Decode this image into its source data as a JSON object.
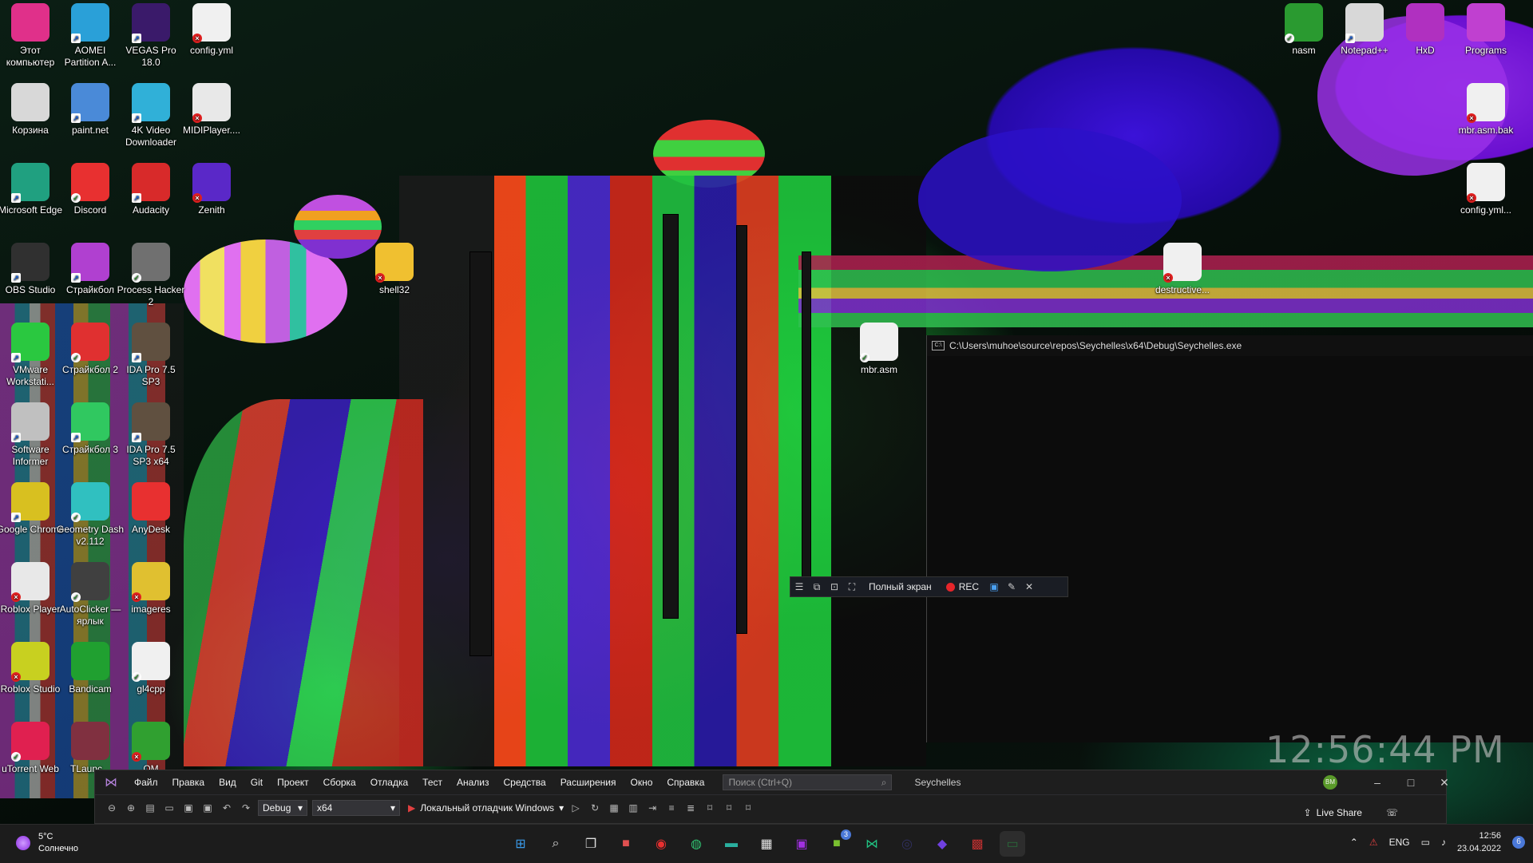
{
  "desktop": {
    "left_icons": [
      {
        "label": "Этот компьютер",
        "icon": "monitor-icon",
        "color": "#e0308a",
        "overlay": ""
      },
      {
        "label": "AOMEI Partition A...",
        "icon": "aomei-icon",
        "color": "#2aa0d8",
        "overlay": "sc"
      },
      {
        "label": "VEGAS Pro 18.0",
        "icon": "vegas-icon",
        "color": "#3a1a6a",
        "overlay": "sc"
      },
      {
        "label": "config.yml",
        "icon": "file-icon",
        "color": "#f0f0f0",
        "overlay": "x"
      },
      {
        "label": "Корзина",
        "icon": "recycle-bin-icon",
        "color": "#d8d8d8",
        "overlay": ""
      },
      {
        "label": "paint.net",
        "icon": "paintnet-icon",
        "color": "#4a8ad8",
        "overlay": "sc"
      },
      {
        "label": "4K Video Downloader",
        "icon": "4k-downloader-icon",
        "color": "#30b0d8",
        "overlay": "sc"
      },
      {
        "label": "MIDIPlayer....",
        "icon": "java-icon",
        "color": "#e8e8e8",
        "overlay": "x"
      },
      {
        "label": "Microsoft Edge",
        "icon": "edge-icon",
        "color": "#20a080",
        "overlay": "sc"
      },
      {
        "label": "Discord",
        "icon": "discord-icon",
        "color": "#e83030",
        "overlay": "ok"
      },
      {
        "label": "Audacity",
        "icon": "audacity-icon",
        "color": "#d82a2a",
        "overlay": "sc"
      },
      {
        "label": "Zenith",
        "icon": "zenith-icon",
        "color": "#5a28c8",
        "overlay": "x"
      },
      {
        "label": "OBS Studio",
        "icon": "obs-icon",
        "color": "#303030",
        "overlay": "sc"
      },
      {
        "label": "Страйкбол",
        "icon": "strikeball-icon",
        "color": "#b040d0",
        "overlay": "sc"
      },
      {
        "label": "Process Hacker 2",
        "icon": "process-hacker-icon",
        "color": "#707070",
        "overlay": "ok"
      },
      {
        "label": "VMware Workstati...",
        "icon": "vmware-icon",
        "color": "#2ac840",
        "overlay": "sc"
      },
      {
        "label": "Страйкбол 2",
        "icon": "strikeball2-icon",
        "color": "#e03030",
        "overlay": "ok"
      },
      {
        "label": "IDA Pro 7.5 SP3",
        "icon": "ida-icon",
        "color": "#605040",
        "overlay": "sc"
      },
      {
        "label": "Software Informer",
        "icon": "software-informer-icon",
        "color": "#c0c0c0",
        "overlay": "sc"
      },
      {
        "label": "Страйкбол 3",
        "icon": "strikeball3-icon",
        "color": "#30c860",
        "overlay": "sc"
      },
      {
        "label": "IDA Pro 7.5 SP3 x64",
        "icon": "ida64-icon",
        "color": "#605040",
        "overlay": "sc"
      },
      {
        "label": "Google Chrome",
        "icon": "chrome-icon",
        "color": "#d8c020",
        "overlay": "sc"
      },
      {
        "label": "Geometry Dash v2.112",
        "icon": "geometry-dash-icon",
        "color": "#30c0c0",
        "overlay": "ok"
      },
      {
        "label": "AnyDesk",
        "icon": "anydesk-icon",
        "color": "#e83030",
        "overlay": ""
      },
      {
        "label": "Roblox Player",
        "icon": "roblox-icon",
        "color": "#e8e8e8",
        "overlay": "x"
      },
      {
        "label": "AutoClicker — ярлык",
        "icon": "autoclicker-icon",
        "color": "#404040",
        "overlay": "ok"
      },
      {
        "label": "imageres",
        "icon": "imageres-icon",
        "color": "#e0c030",
        "overlay": "x"
      },
      {
        "label": "Roblox Studio",
        "icon": "roblox-studio-icon",
        "color": "#c8d020",
        "overlay": "x"
      },
      {
        "label": "Bandicam",
        "icon": "bandicam-icon",
        "color": "#20a030",
        "overlay": ""
      },
      {
        "label": "gl4cpp",
        "icon": "cpp-file-icon",
        "color": "#f0f0f0",
        "overlay": "ok"
      },
      {
        "label": "uTorrent Web",
        "icon": "utorrent-icon",
        "color": "#e02050",
        "overlay": "ok"
      },
      {
        "label": "TLaunc...",
        "icon": "tlauncher-icon",
        "color": "#803040",
        "overlay": ""
      },
      {
        "label": "OM",
        "icon": "om-icon",
        "color": "#30a030",
        "overlay": "x"
      }
    ],
    "right_icons": [
      {
        "label": "nasm",
        "icon": "nasm-icon",
        "color": "#2a9a30",
        "overlay": "ok"
      },
      {
        "label": "Notepad++",
        "icon": "notepadpp-icon",
        "color": "#d8d8d8",
        "overlay": "sc"
      },
      {
        "label": "HxD",
        "icon": "hxd-icon",
        "color": "#b030c0",
        "overlay": ""
      },
      {
        "label": "Programs",
        "icon": "folder-icon",
        "color": "#c040d0",
        "overlay": ""
      },
      {
        "label": "mbr.asm.bak",
        "icon": "file-icon",
        "color": "#f0f0f0",
        "overlay": "x"
      },
      {
        "label": "config.yml...",
        "icon": "file-icon",
        "color": "#f0f0f0",
        "overlay": "x"
      }
    ],
    "floating_icons": [
      {
        "label": "shell32",
        "icon": "folder-icon",
        "color": "#f0c030",
        "overlay": "x"
      },
      {
        "label": "destructive...",
        "icon": "file-icon",
        "color": "#f0f0f0",
        "overlay": "x"
      },
      {
        "label": "mbr.asm",
        "icon": "asm-file-icon",
        "color": "#f0f0f0",
        "overlay": "ok"
      }
    ]
  },
  "console": {
    "title": "C:\\Users\\muhoe\\source\\repos\\Seychelles\\x64\\Debug\\Seychelles.exe",
    "icon_text": "C:\\"
  },
  "bandicam": {
    "fullscreen_label": "Полный экран",
    "rec_label": "REC"
  },
  "overlay_clock": "12:56:44 PM",
  "vs": {
    "menu": [
      "Файл",
      "Правка",
      "Вид",
      "Git",
      "Проект",
      "Сборка",
      "Отладка",
      "Тест",
      "Анализ",
      "Средства",
      "Расширения",
      "Окно",
      "Справка"
    ],
    "search_placeholder": "Поиск (Ctrl+Q)",
    "solution_name": "Seychelles",
    "avatar_initials": "BM",
    "config": "Debug",
    "platform": "x64",
    "debugger_label": "Локальный отладчик Windows",
    "live_share": "Live Share"
  },
  "taskbar": {
    "weather_temp": "5°C",
    "weather_desc": "Солнечно",
    "apps": [
      {
        "name": "start-icon",
        "color": "#3a9ae8"
      },
      {
        "name": "search-icon",
        "color": "#dddddd"
      },
      {
        "name": "task-view-icon",
        "color": "#dddddd"
      },
      {
        "name": "teams-icon",
        "color": "#e05050"
      },
      {
        "name": "discord-taskbar-icon",
        "color": "#e83030"
      },
      {
        "name": "chrome-taskbar-icon",
        "color": "#30c070"
      },
      {
        "name": "explorer-icon",
        "color": "#2ab0a0"
      },
      {
        "name": "store-icon",
        "color": "#e8e8e8"
      },
      {
        "name": "app-purple-icon",
        "color": "#a030e0"
      },
      {
        "name": "minecraft-icon",
        "color": "#7ac030"
      },
      {
        "name": "visual-studio-icon",
        "color": "#20c080"
      },
      {
        "name": "obs-taskbar-icon",
        "color": "#303060"
      },
      {
        "name": "anydesk-taskbar-icon",
        "color": "#7040e0"
      },
      {
        "name": "paint-taskbar-icon",
        "color": "#c03030"
      },
      {
        "name": "console-taskbar-icon",
        "color": "#2a6a3a"
      }
    ],
    "teams_badge": "",
    "minecraft_badge": "3",
    "language": "ENG",
    "time": "12:56",
    "date": "23.04.2022",
    "notification_count": "6"
  }
}
